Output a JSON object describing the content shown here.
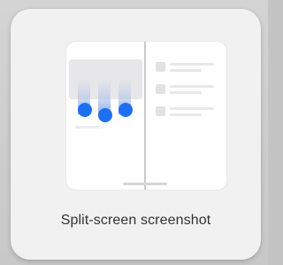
{
  "tile": {
    "label": "Split-screen screenshot",
    "icon": "split-screen-preview-icon"
  },
  "colors": {
    "accent": "#1f6ff2",
    "card_background": "#f1f1f1",
    "label_text": "#333333"
  }
}
